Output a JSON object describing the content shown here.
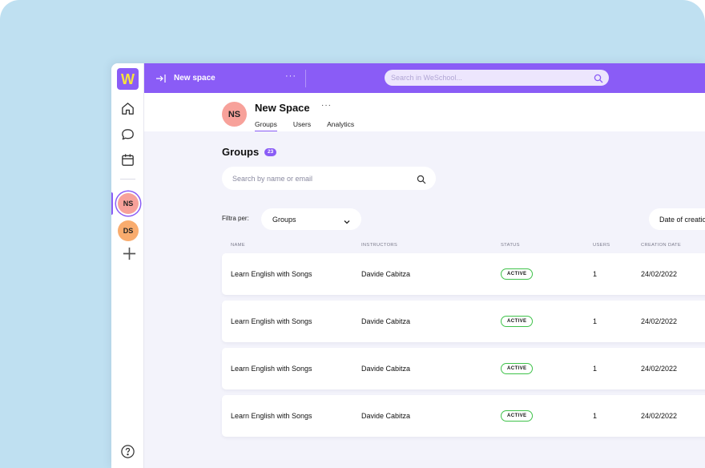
{
  "topbar": {
    "space_title": "New space",
    "more": "···",
    "search_placeholder": "Search in WeSchool..."
  },
  "sidebar": {
    "logo": "W",
    "spaces": [
      {
        "initials": "NS",
        "color": "#f7a19a"
      },
      {
        "initials": "DS",
        "color": "#f9ac6e"
      }
    ]
  },
  "header": {
    "avatar": "NS",
    "title": "New Space",
    "more": "···",
    "tabs": [
      {
        "label": "Groups",
        "active": true
      },
      {
        "label": "Users",
        "active": false
      },
      {
        "label": "Analytics",
        "active": false
      }
    ]
  },
  "groups": {
    "title": "Groups",
    "count": "23",
    "search_placeholder": "Search by name or email",
    "filter_label": "Filtra per:",
    "filter_value": "Groups",
    "sort_value": "Date of creation"
  },
  "table": {
    "columns": [
      "NAME",
      "INSTRUCTORS",
      "STATUS",
      "USERS",
      "CREATION DATE"
    ],
    "rows": [
      {
        "name": "Learn English with Songs",
        "instructor": "Davide Cabitza",
        "status": "ACTIVE",
        "users": "1",
        "date": "24/02/2022"
      },
      {
        "name": "Learn English with Songs",
        "instructor": "Davide Cabitza",
        "status": "ACTIVE",
        "users": "1",
        "date": "24/02/2022"
      },
      {
        "name": "Learn English with Songs",
        "instructor": "Davide Cabitza",
        "status": "ACTIVE",
        "users": "1",
        "date": "24/02/2022"
      },
      {
        "name": "Learn English with Songs",
        "instructor": "Davide Cabitza",
        "status": "ACTIVE",
        "users": "1",
        "date": "24/02/2022"
      }
    ]
  },
  "colors": {
    "brand": "#8a5cf6",
    "status_active": "#3fc24a",
    "background": "#bfe0f1"
  }
}
